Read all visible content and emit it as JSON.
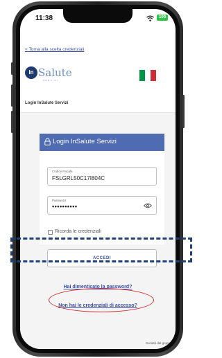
{
  "status_bar": {
    "time": "11:38",
    "battery": "100"
  },
  "nav": {
    "back_label": "< Torna alla scelta credenziali"
  },
  "logo": {
    "mark": "In",
    "word": "Salute",
    "sub": "SERVIZI"
  },
  "flag": {
    "colors": [
      "#009246",
      "#ffffff",
      "#ce2b37"
    ]
  },
  "page_title": "Login InSalute Servizi",
  "card": {
    "title": "Login InSalute Servizi",
    "header_color": "#4f6bb2",
    "codice_fiscale": {
      "label": "Codice Fiscale",
      "value": "FSLGRL50C17I804C"
    },
    "password": {
      "label": "Password",
      "value": "••••••••••"
    },
    "remember_label": "Ricorda le credenziali",
    "login_button": "ACCEDI"
  },
  "links": {
    "forgot_password": "Hai dimenticato la password?",
    "no_credentials": "Non hai le credenziali di accesso?"
  },
  "footer": {
    "text": "Società del gruppo"
  },
  "annotations": {
    "dashed_color": "#1c3f7a",
    "ellipse_color": "#d42a2a"
  }
}
